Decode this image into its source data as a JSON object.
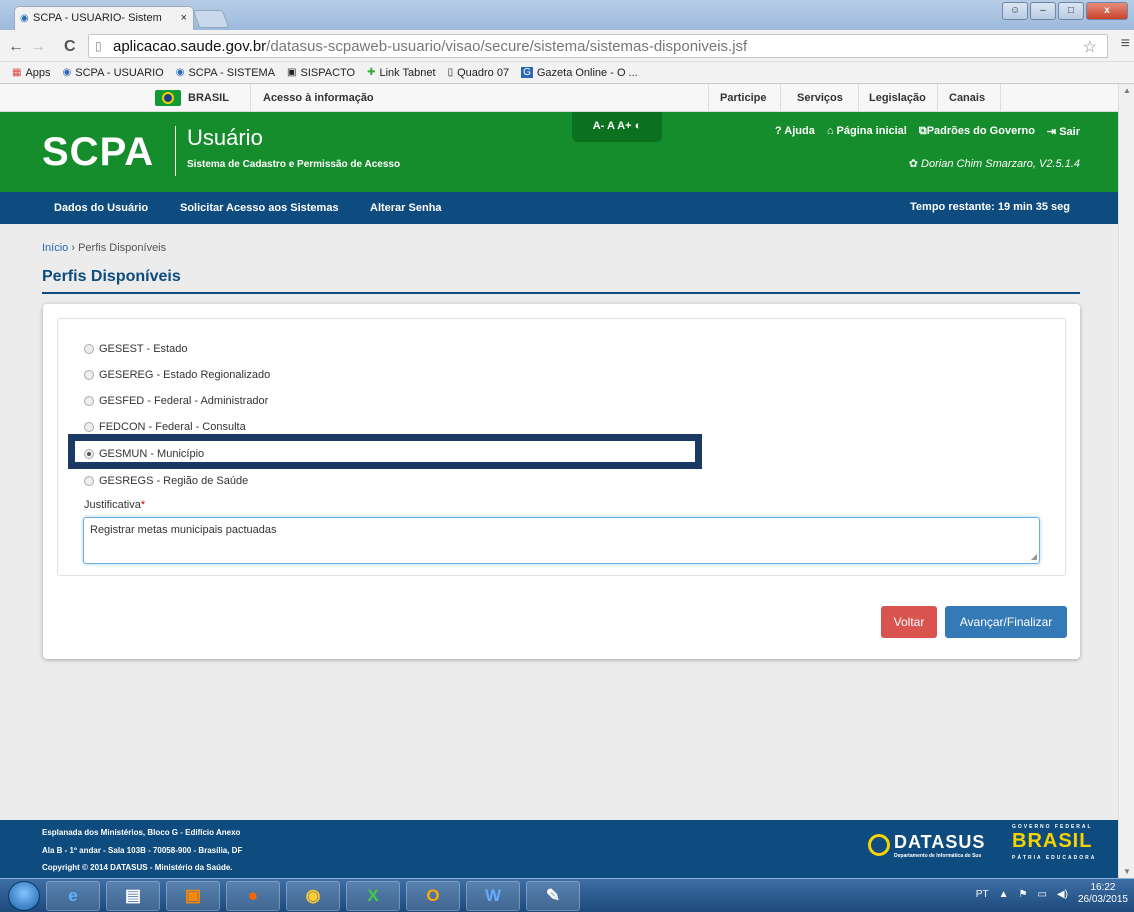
{
  "browser": {
    "tab_title": "SCPA - USUARIO- Sistem",
    "url_host": "aplicacao.saude.gov.br",
    "url_path": "/datasus-scpaweb-usuario/visao/secure/sistema/sistemas-disponiveis.jsf",
    "bookmarks": [
      "Apps",
      "SCPA - USUARIO",
      "SCPA - SISTEMA",
      "SISPACTO",
      "Link Tabnet",
      "Quadro 07",
      "Gazeta Online - O ..."
    ]
  },
  "govbar": {
    "brasil": "BRASIL",
    "acesso": "Acesso à informação",
    "links": [
      "Participe",
      "Serviços",
      "Legislação",
      "Canais"
    ]
  },
  "header": {
    "logo": "SCPA",
    "title": "Usuário",
    "subtitle": "Sistema de Cadastro e Permissão de Acesso",
    "font_controls": "A- A A+ ◐",
    "links": [
      "? Ajuda",
      "⌂ Página inicial",
      "Padrões do Governo",
      "⇥ Sair"
    ],
    "user": "Dorian Chim Smarzaro, V2.5.1.4"
  },
  "nav": {
    "items": [
      "Dados do Usuário",
      "Solicitar Acesso aos Sistemas",
      "Alterar Senha"
    ],
    "timer": "Tempo restante: 19 min 35 seg"
  },
  "page": {
    "breadcrumb_home": "Início",
    "breadcrumb_sep": "›",
    "breadcrumb_current": "Perfis Disponíveis",
    "title": "Perfis Disponíveis",
    "profiles": [
      {
        "label": "GESEST - Estado",
        "selected": false
      },
      {
        "label": "GESEREG - Estado Regionalizado",
        "selected": false
      },
      {
        "label": "GESFED - Federal - Administrador",
        "selected": false
      },
      {
        "label": "FEDCON - Federal - Consulta",
        "selected": false
      },
      {
        "label": "GESMUN - Município",
        "selected": true
      },
      {
        "label": "GESREGS - Região de Saúde",
        "selected": false
      }
    ],
    "justification_label": "Justificativa",
    "required_mark": "*",
    "justification_value": "Registrar metas municipais pactuadas",
    "back_button": "Voltar",
    "next_button": "Avançar/Finalizar"
  },
  "footer": {
    "line1": "Esplanada dos Ministérios, Bloco G - Edifício Anexo",
    "line2": "Ala B - 1º andar - Sala 103B - 70058-900 - Brasília, DF",
    "line3": "Copyright © 2014 DATASUS - Ministério da Saúde."
  },
  "taskbar": {
    "lang": "PT",
    "time": "16:22",
    "date": "26/03/2015"
  },
  "colors": {
    "green": "#168d2c",
    "navy": "#0e4b7e",
    "red_button": "#d9534f",
    "blue_button": "#337ab7"
  }
}
